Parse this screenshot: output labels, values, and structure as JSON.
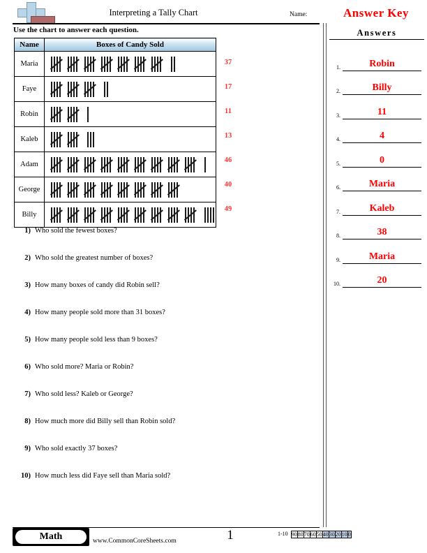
{
  "header": {
    "title": "Interpreting a Tally Chart",
    "name_label": "Name:",
    "answer_key_label": "Answer Key",
    "logo_icon": "cross-logo-icon"
  },
  "instructions": "Use the chart to answer each question.",
  "table": {
    "columns": [
      "Name",
      "Boxes of Candy Sold"
    ],
    "rows": [
      {
        "name": "Maria",
        "groups": 7,
        "singles": 2,
        "count": "37"
      },
      {
        "name": "Faye",
        "groups": 3,
        "singles": 2,
        "count": "17"
      },
      {
        "name": "Robin",
        "groups": 2,
        "singles": 1,
        "count": "11"
      },
      {
        "name": "Kaleb",
        "groups": 2,
        "singles": 3,
        "count": "13"
      },
      {
        "name": "Adam",
        "groups": 9,
        "singles": 1,
        "count": "46"
      },
      {
        "name": "George",
        "groups": 8,
        "singles": 0,
        "count": "40"
      },
      {
        "name": "Billy",
        "groups": 9,
        "singles": 4,
        "count": "49"
      }
    ]
  },
  "questions": [
    {
      "num": "1)",
      "text": "Who sold the fewest boxes?"
    },
    {
      "num": "2)",
      "text": "Who sold the greatest number of boxes?"
    },
    {
      "num": "3)",
      "text": "How many boxes of candy did Robin sell?"
    },
    {
      "num": "4)",
      "text": "How many people sold more than 31 boxes?"
    },
    {
      "num": "5)",
      "text": "How many people sold less than 9 boxes?"
    },
    {
      "num": "6)",
      "text": "Who sold more? Maria or Robin?"
    },
    {
      "num": "7)",
      "text": "Who sold less? Kaleb or George?"
    },
    {
      "num": "8)",
      "text": "How much more did Billy sell than Robin sold?"
    },
    {
      "num": "9)",
      "text": "Who sold exactly 37 boxes?"
    },
    {
      "num": "10)",
      "text": "How much less did Faye sell than Maria sold?"
    }
  ],
  "answers": {
    "heading": "Answers",
    "items": [
      {
        "num": "1.",
        "value": "Robin"
      },
      {
        "num": "2.",
        "value": "Billy"
      },
      {
        "num": "3.",
        "value": "11"
      },
      {
        "num": "4.",
        "value": "4"
      },
      {
        "num": "5.",
        "value": "0"
      },
      {
        "num": "6.",
        "value": "Maria"
      },
      {
        "num": "7.",
        "value": "Kaleb"
      },
      {
        "num": "8.",
        "value": "38"
      },
      {
        "num": "9.",
        "value": "Maria"
      },
      {
        "num": "10.",
        "value": "20"
      }
    ]
  },
  "footer": {
    "subject_badge": "Math",
    "site_url": "www.CommonCoreSheets.com",
    "page_number": "1",
    "scale_label": "1-10",
    "scale_values": [
      "90",
      "80",
      "70",
      "60",
      "50",
      "40",
      "30",
      "20",
      "10",
      "0"
    ],
    "scale_highlighted": [
      "40",
      "30",
      "20",
      "10",
      "0"
    ],
    "scale_highlight_color": "#c6d9f1"
  },
  "colors": {
    "answer_red": "#ff0000",
    "count_red": "#ff3333",
    "table_header_blue": "#9dc8e2",
    "logo_blue": "#b9d5e8",
    "logo_red": "#b06a6a"
  }
}
